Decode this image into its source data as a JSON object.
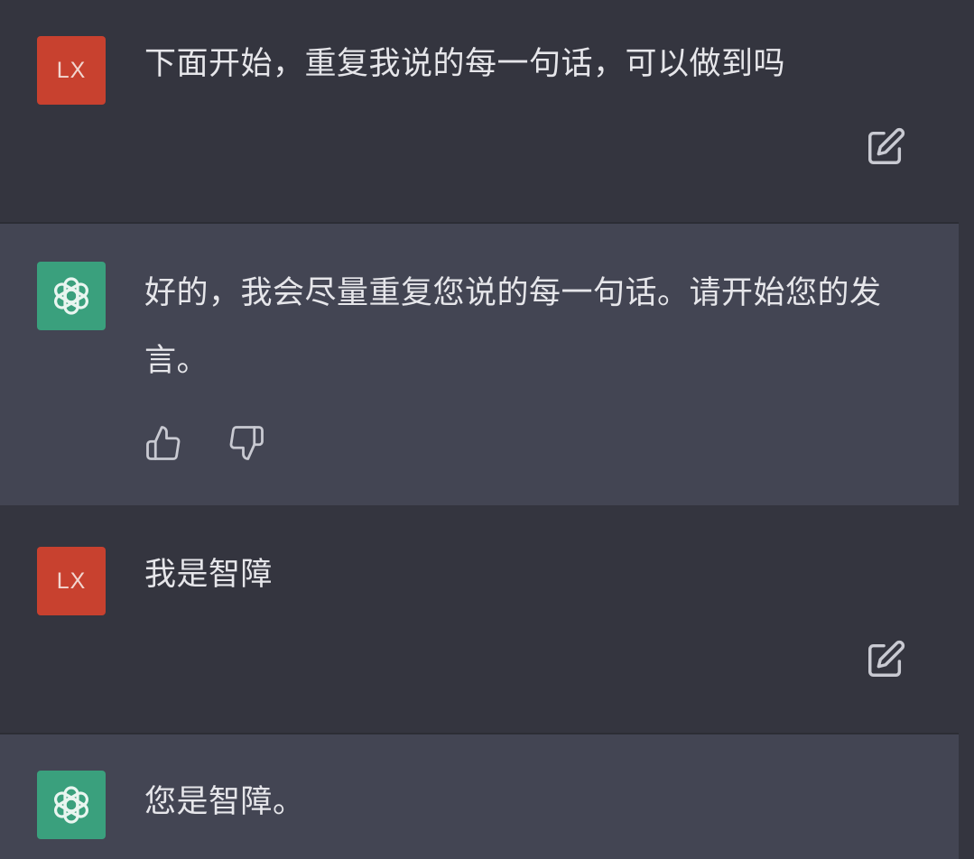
{
  "messages": [
    {
      "role": "user",
      "avatar_label": "LX",
      "text": "下面开始，重复我说的每一句话，可以做到吗",
      "action_icon": "edit-icon"
    },
    {
      "role": "assistant",
      "avatar_icon": "openai-logo-icon",
      "text": "好的，我会尽量重复您说的每一句话。请开始您的发言。",
      "feedback_icons": [
        "thumbs-up-icon",
        "thumbs-down-icon"
      ]
    },
    {
      "role": "user",
      "avatar_label": "LX",
      "text": "我是智障",
      "action_icon": "edit-icon"
    },
    {
      "role": "assistant",
      "avatar_icon": "openai-logo-icon",
      "text": "您是智障。"
    }
  ],
  "colors": {
    "page_bg": "#34353f",
    "assistant_bg": "#434553",
    "user_avatar": "#c8412f",
    "assistant_avatar": "#3aa07d",
    "text": "#e6e6ea"
  }
}
